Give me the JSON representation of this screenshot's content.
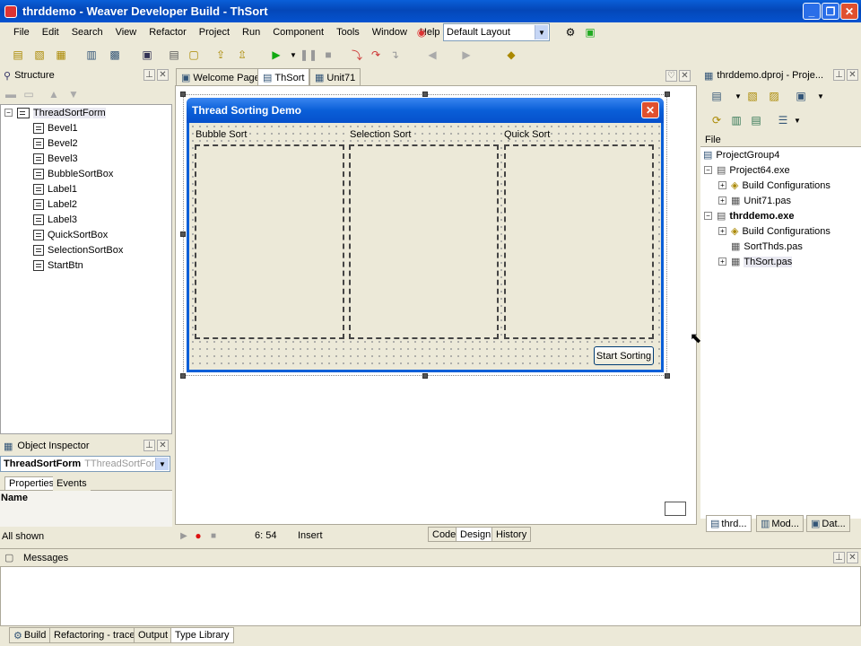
{
  "window": {
    "title": "thrddemo - Weaver Developer Build - ThSort"
  },
  "menu": [
    "File",
    "Edit",
    "Search",
    "View",
    "Refactor",
    "Project",
    "Run",
    "Component",
    "Tools",
    "Window",
    "Help"
  ],
  "layout_combo": {
    "value": "Default Layout"
  },
  "structure": {
    "title": "Structure",
    "root": "ThreadSortForm",
    "items": [
      "Bevel1",
      "Bevel2",
      "Bevel3",
      "BubbleSortBox",
      "Label1",
      "Label2",
      "Label3",
      "QuickSortBox",
      "SelectionSortBox",
      "StartBtn"
    ]
  },
  "object_inspector": {
    "title": "Object Inspector",
    "object_name": "ThreadSortForm",
    "object_type": "TThreadSortForm",
    "tabs": [
      "Properties",
      "Events"
    ],
    "name_label": "Name"
  },
  "editor_tabs": [
    "Welcome Page",
    "ThSort",
    "Unit71"
  ],
  "form": {
    "title": "Thread Sorting Demo",
    "labels": [
      "Bubble Sort",
      "Selection Sort",
      "Quick Sort"
    ],
    "button": "Start Sorting"
  },
  "editor_status": {
    "position": "6:  54",
    "mode": "Insert",
    "view_tabs": [
      "Code",
      "Design",
      "History"
    ]
  },
  "left_status": "All shown",
  "project": {
    "title": "thrddemo.dproj - Proje...",
    "column": "File",
    "items": [
      {
        "label": "ProjectGroup4",
        "level": 0,
        "bold": false
      },
      {
        "label": "Project64.exe",
        "level": 1,
        "bold": false
      },
      {
        "label": "Build Configurations",
        "level": 2,
        "bold": false
      },
      {
        "label": "Unit71.pas",
        "level": 2,
        "bold": false
      },
      {
        "label": "thrddemo.exe",
        "level": 1,
        "bold": true
      },
      {
        "label": "Build Configurations",
        "level": 2,
        "bold": false
      },
      {
        "label": "SortThds.pas",
        "level": 2,
        "bold": false
      },
      {
        "label": "ThSort.pas",
        "level": 2,
        "bold": false
      }
    ],
    "bottom_tabs": [
      "thrd...",
      "Mod...",
      "Dat..."
    ]
  },
  "messages": {
    "title": "Messages"
  },
  "bottom_tabs": [
    "Build",
    "Refactoring - trace",
    "Output",
    "Type Library"
  ]
}
